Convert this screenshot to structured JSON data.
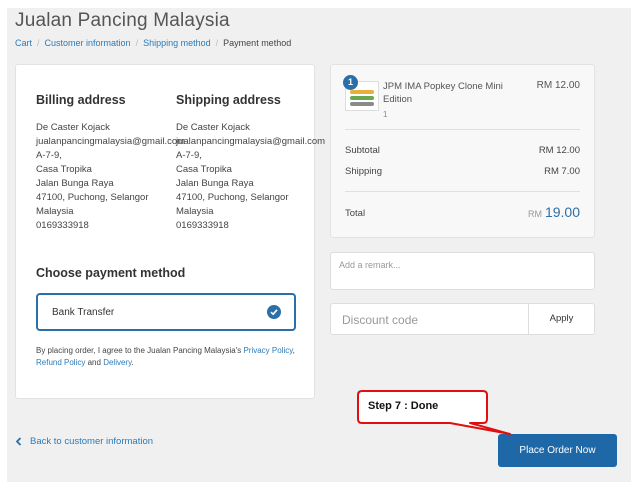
{
  "store": {
    "title": "Jualan Pancing Malaysia"
  },
  "breadcrumb": [
    "Cart",
    "Customer information",
    "Shipping method",
    "Payment method"
  ],
  "billing": {
    "heading": "Billing address",
    "lines": [
      "De Caster Kojack",
      "jualanpancingmalaysia@gmail.com",
      "A-7-9,",
      "Casa Tropika",
      "Jalan Bunga Raya",
      "47100, Puchong, Selangor",
      "Malaysia",
      "0169333918"
    ]
  },
  "shipping": {
    "heading": "Shipping address",
    "lines": [
      "De Caster Kojack",
      "jualanpancingmalaysia@gmail.com",
      "A-7-9,",
      "Casa Tropika",
      "Jalan Bunga Raya",
      "47100, Puchong, Selangor",
      "Malaysia",
      "0169333918"
    ]
  },
  "payment": {
    "heading": "Choose payment method",
    "option": "Bank Transfer",
    "policy_prefix": "By placing order, I agree to the Jualan Pancing Malaysia's",
    "privacy": "Privacy Policy",
    "refund": "Refund Policy",
    "and": "and",
    "delivery": "Delivery",
    "period": "."
  },
  "summary": {
    "qty": "1",
    "product_name": "JPM IMA Popkey Clone Mini Edition",
    "product_sub": "1",
    "product_price": "RM 12.00",
    "subtotal_label": "Subtotal",
    "subtotal_value": "RM 12.00",
    "shipping_label": "Shipping",
    "shipping_value": "RM 7.00",
    "total_label": "Total",
    "total_currency": "RM",
    "total_value": "19.00"
  },
  "remark": {
    "placeholder": "Add a remark..."
  },
  "discount": {
    "placeholder": "Discount code",
    "apply": "Apply"
  },
  "footer": {
    "back": "Back to customer information",
    "place_order": "Place Order Now"
  },
  "annotation": {
    "text": "Step 7 : Done",
    "color": "#e01010"
  },
  "colors": {
    "accent": "#1f68a8",
    "link": "#2b7bb9"
  }
}
